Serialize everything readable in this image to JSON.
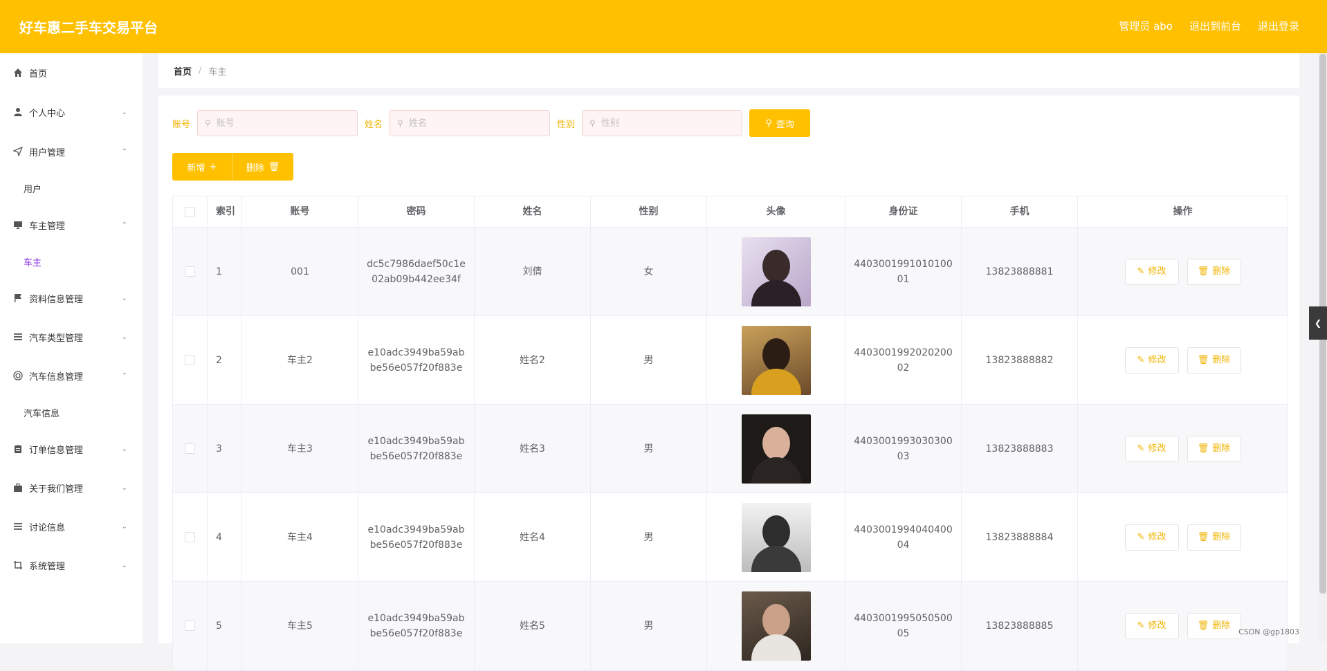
{
  "header": {
    "title": "好车惠二手车交易平台",
    "admin": "管理员 abo",
    "to_front": "退出到前台",
    "logout": "退出登录"
  },
  "sidebar": {
    "items": [
      {
        "label": "首页",
        "icon": "home-icon",
        "chevron": ""
      },
      {
        "label": "个人中心",
        "icon": "user-icon",
        "chevron": "down"
      },
      {
        "label": "用户管理",
        "icon": "send-icon",
        "chevron": "up"
      },
      {
        "label": "车主管理",
        "icon": "monitor-icon",
        "chevron": "up"
      },
      {
        "label": "资料信息管理",
        "icon": "flag-icon",
        "chevron": "down"
      },
      {
        "label": "汽车类型管理",
        "icon": "list-icon",
        "chevron": "down"
      },
      {
        "label": "汽车信息管理",
        "icon": "lifebuoy-icon",
        "chevron": "up"
      },
      {
        "label": "订单信息管理",
        "icon": "clipboard-icon",
        "chevron": "down"
      },
      {
        "label": "关于我们管理",
        "icon": "briefcase-icon",
        "chevron": "down"
      },
      {
        "label": "讨论信息",
        "icon": "list-icon",
        "chevron": "down"
      },
      {
        "label": "系统管理",
        "icon": "crop-icon",
        "chevron": "down"
      }
    ],
    "subitems": {
      "users": "用户",
      "owners": "车主",
      "cars": "汽车信息"
    }
  },
  "breadcrumb": {
    "home": "首页",
    "current": "车主"
  },
  "search": {
    "account_label": "账号",
    "account_placeholder": "账号",
    "name_label": "姓名",
    "name_placeholder": "姓名",
    "gender_label": "性别",
    "gender_placeholder": "性别",
    "query_button": "查询"
  },
  "toolbar": {
    "add_label": "新增",
    "delete_label": "删除"
  },
  "table": {
    "columns": [
      "索引",
      "账号",
      "密码",
      "姓名",
      "性别",
      "头像",
      "身份证",
      "手机",
      "操作"
    ],
    "rows": [
      {
        "index": "1",
        "account": "001",
        "password": "dc5c7986daef50c1e02ab09b442ee34f",
        "name": "刘倩",
        "gender": "女",
        "id_card": "440300199101010001",
        "phone": "13823888881"
      },
      {
        "index": "2",
        "account": "车主2",
        "password": "e10adc3949ba59abbe56e057f20f883e",
        "name": "姓名2",
        "gender": "男",
        "id_card": "440300199202020002",
        "phone": "13823888882"
      },
      {
        "index": "3",
        "account": "车主3",
        "password": "e10adc3949ba59abbe56e057f20f883e",
        "name": "姓名3",
        "gender": "男",
        "id_card": "440300199303030003",
        "phone": "13823888883"
      },
      {
        "index": "4",
        "account": "车主4",
        "password": "e10adc3949ba59abbe56e057f20f883e",
        "name": "姓名4",
        "gender": "男",
        "id_card": "440300199404040004",
        "phone": "13823888884"
      },
      {
        "index": "5",
        "account": "车主5",
        "password": "e10adc3949ba59abbe56e057f20f883e",
        "name": "姓名5",
        "gender": "男",
        "id_card": "440300199505050005",
        "phone": "13823888885"
      }
    ],
    "edit_label": "修改",
    "delete_label": "删除"
  },
  "colors": {
    "accent": "#ffc000",
    "active_sub": "#8a2be2"
  },
  "watermark": "CSDN @gp1803"
}
